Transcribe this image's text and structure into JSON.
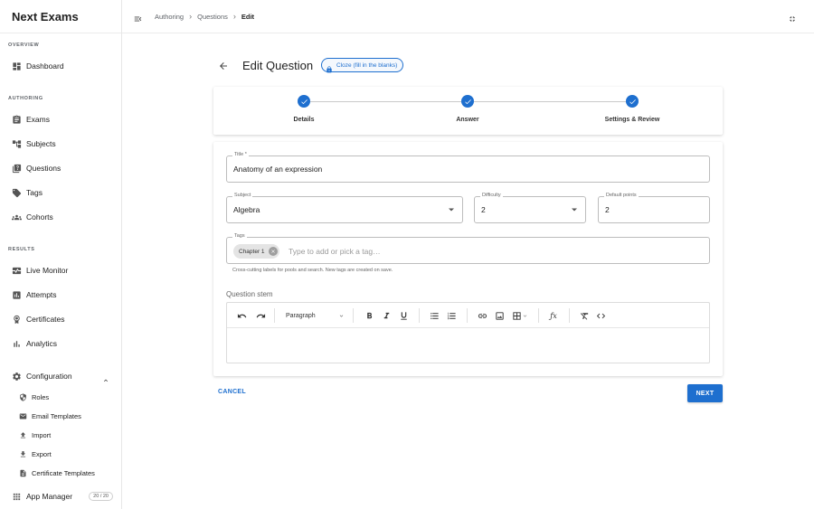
{
  "app": {
    "title": "Next Exams"
  },
  "sidebar": {
    "sections": {
      "overview": "OVERVIEW",
      "authoring": "AUTHORING",
      "results": "RESULTS"
    },
    "items": {
      "dashboard": "Dashboard",
      "exams": "Exams",
      "subjects": "Subjects",
      "questions": "Questions",
      "tags": "Tags",
      "cohorts": "Cohorts",
      "live_monitor": "Live Monitor",
      "attempts": "Attempts",
      "certificates": "Certificates",
      "analytics": "Analytics",
      "configuration": "Configuration",
      "app_manager": "App Manager"
    },
    "config_children": {
      "roles": "Roles",
      "email_templates": "Email Templates",
      "import": "Import",
      "export": "Export",
      "certificate_templates": "Certificate Templates"
    },
    "app_manager_count": "20 / 20"
  },
  "breadcrumb": {
    "items": [
      "Authoring",
      "Questions"
    ],
    "current": "Edit"
  },
  "page": {
    "title": "Edit Question",
    "type_chip": "Cloze (fill in the blanks)"
  },
  "stepper": {
    "steps": [
      "Details",
      "Answer",
      "Settings & Review"
    ]
  },
  "form": {
    "title": {
      "label": "Title *",
      "value": "Anatomy of an expression"
    },
    "subject": {
      "label": "Subject",
      "value": "Algebra"
    },
    "difficulty": {
      "label": "Difficulty",
      "value": "2"
    },
    "points": {
      "label": "Default points",
      "value": "2"
    },
    "tags": {
      "label": "Tags",
      "chip": "Chapter 1",
      "placeholder": "Type to add or pick a tag…",
      "helper": "Cross-cutting labels for pools and search. New tags are created on save."
    },
    "stem": {
      "label": "Question stem",
      "paragraph": "Paragraph"
    }
  },
  "actions": {
    "cancel": "CANCEL",
    "next": "NEXT"
  },
  "colors": {
    "accent": "#1e6fcf"
  }
}
